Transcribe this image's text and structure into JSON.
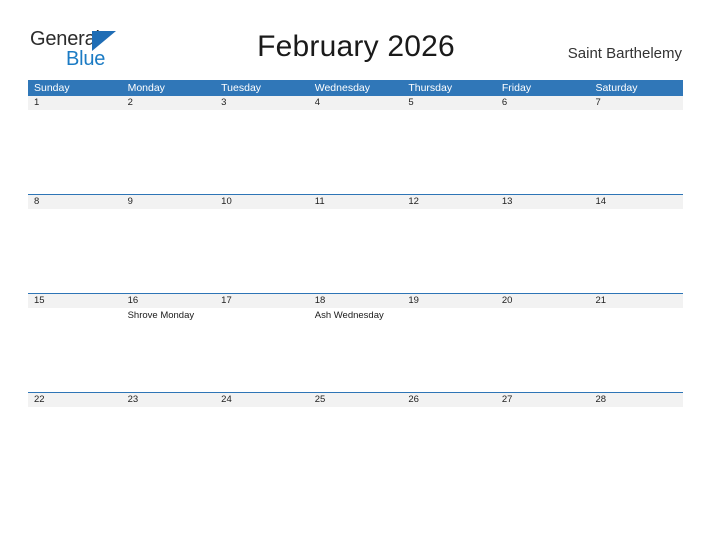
{
  "brand": {
    "word_one": "General",
    "word_two": "Blue",
    "triangle_icon": "blue-triangle-icon",
    "color_dark": "#2b2b2b",
    "color_blue": "#1b7bc4"
  },
  "header": {
    "title": "February 2026",
    "region": "Saint Barthelemy"
  },
  "theme": {
    "header_blue": "#3077b8",
    "row_divider_blue": "#2e75b6",
    "day_strip_gray": "#f2f2f2",
    "text_dark": "#1a1a1a"
  },
  "calendar": {
    "weekdays": [
      "Sunday",
      "Monday",
      "Tuesday",
      "Wednesday",
      "Thursday",
      "Friday",
      "Saturday"
    ],
    "weeks": [
      [
        {
          "day": "1",
          "events": []
        },
        {
          "day": "2",
          "events": []
        },
        {
          "day": "3",
          "events": []
        },
        {
          "day": "4",
          "events": []
        },
        {
          "day": "5",
          "events": []
        },
        {
          "day": "6",
          "events": []
        },
        {
          "day": "7",
          "events": []
        }
      ],
      [
        {
          "day": "8",
          "events": []
        },
        {
          "day": "9",
          "events": []
        },
        {
          "day": "10",
          "events": []
        },
        {
          "day": "11",
          "events": []
        },
        {
          "day": "12",
          "events": []
        },
        {
          "day": "13",
          "events": []
        },
        {
          "day": "14",
          "events": []
        }
      ],
      [
        {
          "day": "15",
          "events": []
        },
        {
          "day": "16",
          "events": [
            "Shrove Monday"
          ]
        },
        {
          "day": "17",
          "events": []
        },
        {
          "day": "18",
          "events": [
            "Ash Wednesday"
          ]
        },
        {
          "day": "19",
          "events": []
        },
        {
          "day": "20",
          "events": []
        },
        {
          "day": "21",
          "events": []
        }
      ],
      [
        {
          "day": "22",
          "events": []
        },
        {
          "day": "23",
          "events": []
        },
        {
          "day": "24",
          "events": []
        },
        {
          "day": "25",
          "events": []
        },
        {
          "day": "26",
          "events": []
        },
        {
          "day": "27",
          "events": []
        },
        {
          "day": "28",
          "events": []
        },
        {
          "day": "",
          "events": []
        }
      ]
    ]
  }
}
